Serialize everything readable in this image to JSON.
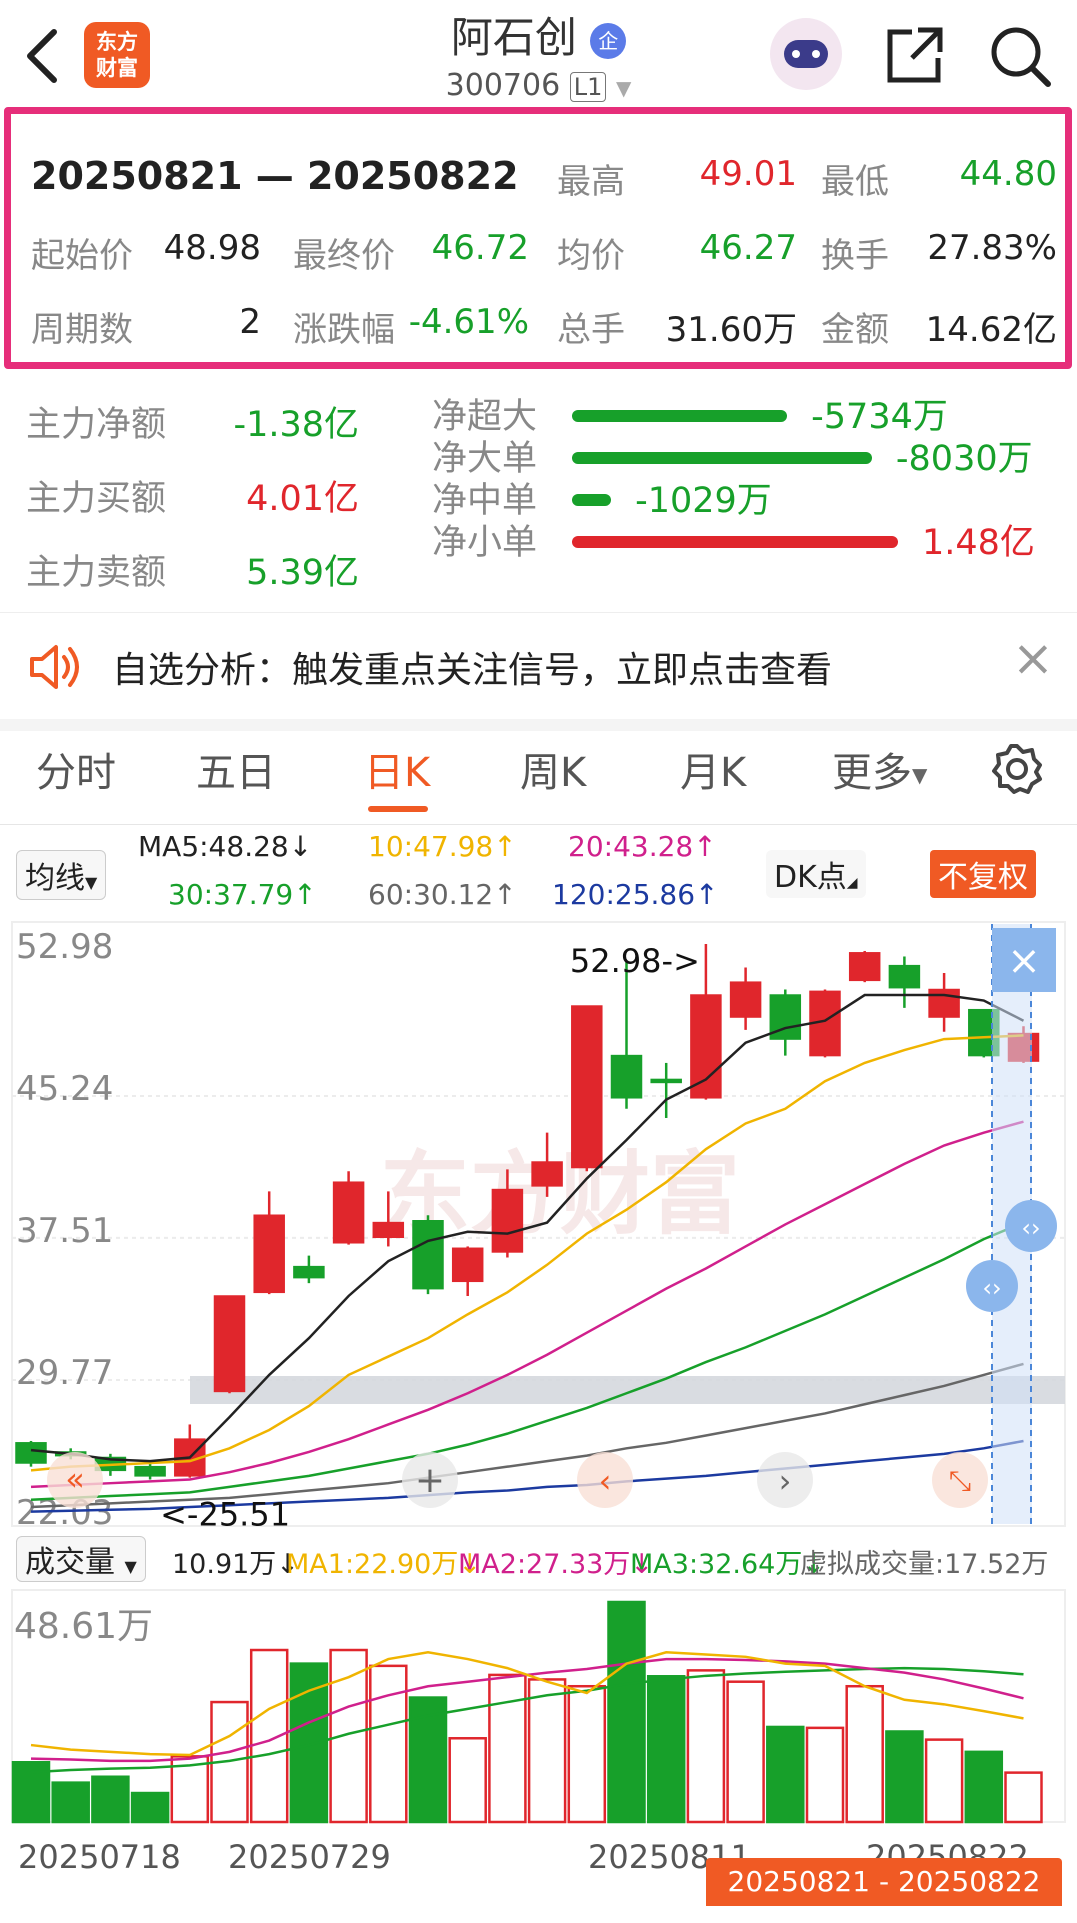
{
  "header": {
    "back_icon": "chevron-left-icon",
    "logo_lines": [
      "东方",
      "财富"
    ],
    "title": "阿石创",
    "title_badge": "企",
    "code": "300706",
    "level": "L1",
    "share_icon": "share-icon",
    "search_icon": "search-icon"
  },
  "period": {
    "range": "20250821 — 20250822",
    "high_label": "最高",
    "high": "49.01",
    "low_label": "最低",
    "low": "44.80",
    "open_label": "起始价",
    "open": "48.98",
    "close_label": "最终价",
    "close": "46.72",
    "avg_label": "均价",
    "avg": "46.27",
    "turnover_label": "换手",
    "turnover": "27.83%",
    "count_label": "周期数",
    "count": "2",
    "change_label": "涨跌幅",
    "change": "-4.61%",
    "volume_label": "总手",
    "volume": "31.60万",
    "amount_label": "金额",
    "amount": "14.62亿"
  },
  "flow": {
    "main_net_label": "主力净额",
    "main_net": "-1.38亿",
    "main_buy_label": "主力买额",
    "main_buy": "4.01亿",
    "main_sell_label": "主力卖额",
    "main_sell": "5.39亿",
    "items": [
      {
        "label": "净超大",
        "value": "-5734万",
        "ratio": 0.66,
        "color": "green"
      },
      {
        "label": "净大单",
        "value": "-8030万",
        "ratio": 0.92,
        "color": "green"
      },
      {
        "label": "净中单",
        "value": "-1029万",
        "ratio": 0.12,
        "color": "green"
      },
      {
        "label": "净小单",
        "value": "1.48亿",
        "ratio": 1.0,
        "color": "red"
      }
    ]
  },
  "notice": {
    "text": "自选分析：触发重点关注信号，立即点击查看",
    "close": "×"
  },
  "tabs": [
    "分时",
    "五日",
    "日K",
    "周K",
    "月K",
    "更多"
  ],
  "active_tab": "日K",
  "ma": {
    "selector": "均线",
    "ma5": "MA5:48.28↓",
    "ma10": "10:47.98↑",
    "ma20": "20:43.28↑",
    "ma30": "30:37.79↑",
    "ma60": "60:30.12↑",
    "ma120": "120:25.86↑",
    "dk": "DK点",
    "adjust": "不复权"
  },
  "kline": {
    "y_labels": [
      "52.98",
      "45.24",
      "37.51",
      "29.77",
      "22.03"
    ],
    "high_marker": "52.98->",
    "low_marker": "<-25.51",
    "watermark": "东方财富"
  },
  "volume": {
    "selector": "成交量",
    "current": "10.91万↓",
    "ma1": "MA1:22.90万↓",
    "ma2": "MA2:27.33万↓",
    "ma3": "MA3:32.64万↓",
    "virtual": "虚拟成交量:17.52万",
    "max_label": "48.61万"
  },
  "x_labels": [
    "20250718",
    "20250729",
    "20250811",
    "20250822"
  ],
  "selected_range": "20250821 - 20250822",
  "colors": {
    "up": "#e0262c",
    "down": "#17a02a",
    "accent": "#f05a24",
    "period_border": "#e62e7a"
  },
  "chart_data": {
    "type": "candlestick",
    "ylim": [
      22.03,
      52.98
    ],
    "candles": [
      {
        "o": 25.8,
        "c": 24.7,
        "h": 25.9,
        "l": 24.5
      },
      {
        "o": 25.3,
        "c": 25.1,
        "h": 25.5,
        "l": 24.9
      },
      {
        "o": 25.0,
        "c": 24.3,
        "h": 25.2,
        "l": 24.0
      },
      {
        "o": 24.5,
        "c": 24.0,
        "h": 24.7,
        "l": 23.8
      },
      {
        "o": 24.0,
        "c": 26.0,
        "h": 26.8,
        "l": 23.9
      },
      {
        "o": 28.6,
        "c": 33.8,
        "h": 33.8,
        "l": 28.5
      },
      {
        "o": 34.0,
        "c": 38.2,
        "h": 39.5,
        "l": 33.9
      },
      {
        "o": 35.4,
        "c": 34.8,
        "h": 36.0,
        "l": 34.5
      },
      {
        "o": 36.7,
        "c": 40.0,
        "h": 40.6,
        "l": 36.6
      },
      {
        "o": 37.0,
        "c": 37.8,
        "h": 39.5,
        "l": 36.5
      },
      {
        "o": 37.9,
        "c": 34.2,
        "h": 38.2,
        "l": 33.9
      },
      {
        "o": 34.6,
        "c": 36.4,
        "h": 36.5,
        "l": 33.8
      },
      {
        "o": 36.2,
        "c": 39.6,
        "h": 40.7,
        "l": 35.9
      },
      {
        "o": 39.8,
        "c": 41.1,
        "h": 42.7,
        "l": 39.2
      },
      {
        "o": 40.8,
        "c": 49.6,
        "h": 49.6,
        "l": 40.6
      },
      {
        "o": 46.9,
        "c": 44.6,
        "h": 52.0,
        "l": 44.0
      },
      {
        "o": 45.6,
        "c": 45.5,
        "h": 46.5,
        "l": 43.5
      },
      {
        "o": 44.6,
        "c": 50.2,
        "h": 52.98,
        "l": 44.5
      },
      {
        "o": 49.0,
        "c": 50.9,
        "h": 51.7,
        "l": 48.3
      },
      {
        "o": 50.2,
        "c": 47.8,
        "h": 50.5,
        "l": 46.9
      },
      {
        "o": 46.9,
        "c": 50.4,
        "h": 50.5,
        "l": 46.8
      },
      {
        "o": 51.0,
        "c": 52.5,
        "h": 52.6,
        "l": 50.9
      },
      {
        "o": 51.8,
        "c": 50.6,
        "h": 52.3,
        "l": 49.5
      },
      {
        "o": 49.0,
        "c": 50.5,
        "h": 51.4,
        "l": 48.2
      },
      {
        "o": 49.4,
        "c": 46.9,
        "h": 49.4,
        "l": 46.8
      },
      {
        "o": 46.6,
        "c": 48.1,
        "h": 48.5,
        "l": 46.5
      }
    ],
    "ma5": [
      25.4,
      25.2,
      24.9,
      24.8,
      25.0,
      27.2,
      29.5,
      31.5,
      33.8,
      35.7,
      36.8,
      37.3,
      37.2,
      37.8,
      40.2,
      42.3,
      44.5,
      45.6,
      47.6,
      48.4,
      48.8,
      50.2,
      50.2,
      50.2,
      49.9,
      48.8
    ],
    "ma10": [
      24.3,
      24.5,
      24.6,
      24.7,
      24.8,
      25.5,
      26.5,
      27.8,
      29.5,
      30.5,
      31.5,
      32.8,
      34.0,
      35.5,
      37.2,
      38.5,
      40.0,
      41.8,
      43.2,
      44.0,
      45.5,
      46.5,
      47.2,
      47.8,
      47.9,
      48.0
    ],
    "ma20": [
      23.4,
      23.5,
      23.6,
      23.7,
      23.8,
      24.2,
      24.7,
      25.3,
      26.0,
      26.8,
      27.6,
      28.5,
      29.5,
      30.6,
      31.8,
      33.0,
      34.2,
      35.3,
      36.5,
      37.7,
      38.8,
      39.9,
      41.0,
      42.0,
      42.7,
      43.3
    ],
    "ma30": [
      22.7,
      22.8,
      22.9,
      23.0,
      23.1,
      23.4,
      23.7,
      24.0,
      24.4,
      24.8,
      25.2,
      25.7,
      26.3,
      27.0,
      27.7,
      28.5,
      29.3,
      30.2,
      31.0,
      31.9,
      32.8,
      33.8,
      34.8,
      35.8,
      36.9,
      37.8
    ],
    "ma60": [
      22.3,
      22.4,
      22.5,
      22.6,
      22.7,
      22.8,
      23.0,
      23.2,
      23.4,
      23.6,
      23.9,
      24.2,
      24.5,
      24.8,
      25.1,
      25.5,
      25.8,
      26.2,
      26.6,
      27.0,
      27.4,
      27.9,
      28.4,
      28.9,
      29.5,
      30.1
    ],
    "ma120": [
      22.05,
      22.1,
      22.15,
      22.2,
      22.3,
      22.4,
      22.5,
      22.6,
      22.7,
      22.8,
      22.95,
      23.1,
      23.2,
      23.4,
      23.5,
      23.7,
      23.85,
      24.0,
      24.2,
      24.4,
      24.6,
      24.8,
      25.0,
      25.2,
      25.5,
      25.9
    ],
    "volume": [
      13.2,
      8.7,
      10.0,
      6.4,
      14.5,
      26.5,
      38.0,
      35.0,
      38.0,
      34.5,
      27.5,
      18.5,
      32.5,
      31.5,
      30.0,
      48.61,
      32.2,
      33.5,
      31.0,
      21.0,
      20.8,
      30.0,
      20.0,
      18.2,
      15.5,
      10.91
    ],
    "vol_ma1": [
      17.0,
      16.0,
      15.5,
      15.0,
      14.8,
      19.0,
      25.0,
      29.0,
      32.0,
      36.0,
      37.5,
      36.0,
      34.0,
      31.0,
      28.5,
      35.0,
      37.5,
      37.0,
      36.5,
      35.0,
      34.5,
      30.0,
      27.0,
      26.0,
      24.5,
      22.9
    ],
    "vol_ma2": [
      14.0,
      13.8,
      13.5,
      13.5,
      14.0,
      15.5,
      18.0,
      22.0,
      25.5,
      28.0,
      30.0,
      31.0,
      32.0,
      33.0,
      33.8,
      35.0,
      36.0,
      36.0,
      35.8,
      35.5,
      35.0,
      34.0,
      33.0,
      31.5,
      29.5,
      27.33
    ],
    "vol_ma3": [
      11.0,
      11.5,
      11.8,
      12.0,
      12.5,
      13.5,
      15.0,
      17.0,
      19.5,
      21.5,
      23.5,
      25.0,
      26.5,
      28.0,
      29.0,
      30.5,
      31.5,
      32.3,
      32.8,
      33.2,
      33.5,
      33.8,
      34.0,
      33.8,
      33.3,
      32.64
    ],
    "vol_max": 48.61
  }
}
